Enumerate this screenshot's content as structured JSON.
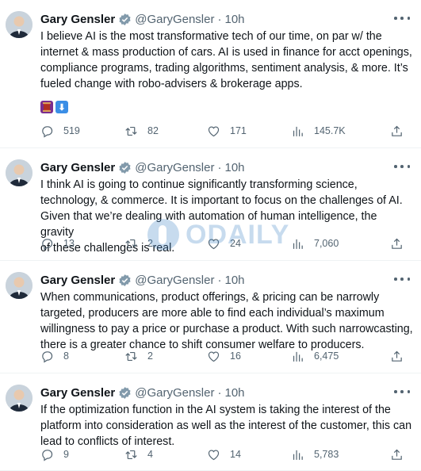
{
  "tweets": [
    {
      "name": "Gary Gensler",
      "handle": "@GaryGensler",
      "time": "10h",
      "text": "I believe AI is the most transformative tech of our time, on par w/ the\ninternet & mass production of cars. AI is used in finance for acct openings,\ncompliance programs, trading algorithms, sentiment analysis, & more. It’s\nfueled change with robo-advisers & brokerage apps.",
      "emojis": [
        "thread-spool-emoji",
        "down-arrow-emoji"
      ],
      "replies": "519",
      "retweets": "82",
      "likes": "171",
      "views": "145.7K"
    },
    {
      "name": "Gary Gensler",
      "handle": "@GaryGensler",
      "time": "10h",
      "text": "I think AI is going to continue significantly transforming science,\ntechnology, & commerce. It is important to focus on the challenges of AI.\nGiven that we’re dealing with automation of human intelligence, the gravity\nof these challenges is real.",
      "replies": "13",
      "retweets": "2",
      "likes": "24",
      "views": "7,060"
    },
    {
      "name": "Gary Gensler",
      "handle": "@GaryGensler",
      "time": "10h",
      "text": "When communications, product offerings, & pricing can be narrowly\ntargeted, producers are more able to find each individual’s maximum\nwillingness to pay a price or purchase a product. With such narrowcasting,\nthere is a greater chance to shift consumer welfare to producers.",
      "replies": "8",
      "retweets": "2",
      "likes": "16",
      "views": "6,475"
    },
    {
      "name": "Gary Gensler",
      "handle": "@GaryGensler",
      "time": "10h",
      "text": "If the optimization function in the AI system is taking the interest of the\nplatform into consideration as well as the interest of the customer, this can\nlead to conflicts of interest.",
      "replies": "9",
      "retweets": "4",
      "likes": "14",
      "views": "5,783"
    }
  ],
  "watermark": "ODAILY",
  "colors": {
    "text": "#0f1419",
    "muted": "#536471",
    "verified": "#829aab",
    "watermark": "#3b82c4"
  }
}
